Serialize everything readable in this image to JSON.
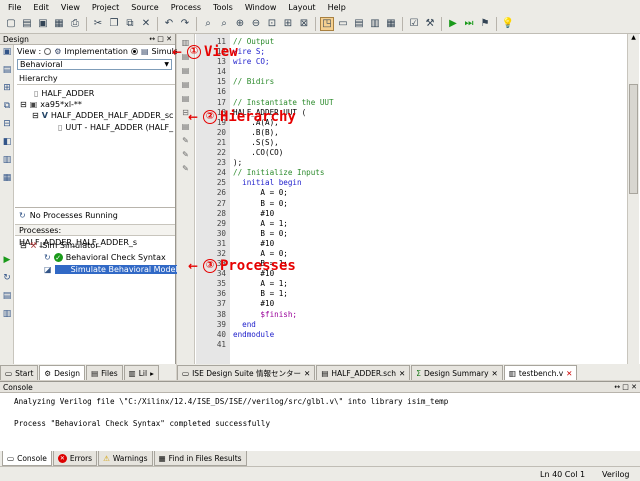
{
  "menu": [
    "File",
    "Edit",
    "View",
    "Project",
    "Source",
    "Process",
    "Tools",
    "Window",
    "Layout",
    "Help"
  ],
  "left": {
    "title": "Design",
    "view_label": "View :",
    "impl_label": "Implementation",
    "sim_label": "Simulation",
    "behavior_select": "Behavioral",
    "hierarchy_label": "Hierarchy",
    "tree": [
      "HALF_ADDER",
      "xa95*xl-**",
      "HALF_ADDER_HALF_ADDER_sc",
      "UUT - HALF_ADDER (HALF_"
    ],
    "no_processes": "No Processes Running",
    "processes_label": "Processes: HALF_ADDER_HALF_ADDER_s",
    "processes": [
      "ISim Simulator",
      "Behavioral Check Syntax",
      "Simulate Behavioral Model"
    ]
  },
  "left_tabs": [
    "Start",
    "Design",
    "Files",
    "Lil"
  ],
  "editor": {
    "line_numbers": [
      "11",
      "12",
      "13",
      "14",
      "15",
      "16",
      "17",
      "18",
      "19",
      "20",
      "21",
      "22",
      "23",
      "24",
      "25",
      "26",
      "27",
      "28",
      "29",
      "30",
      "31",
      "32",
      "33",
      "34",
      "35",
      "36",
      "37",
      "38",
      "39",
      "40",
      "41"
    ],
    "lines": [
      {
        "t": "// Output",
        "c": "cmt"
      },
      {
        "t": "wire S;",
        "c": "kw"
      },
      {
        "t": "wire CO;",
        "c": "kw"
      },
      {
        "t": "",
        "c": ""
      },
      {
        "t": "// Bidirs",
        "c": "cmt"
      },
      {
        "t": "",
        "c": ""
      },
      {
        "t": "// Instantiate the UUT",
        "c": "cmt"
      },
      {
        "t": "HALF_ADDER UUT (",
        "c": ""
      },
      {
        "t": "    .A(A),",
        "c": ""
      },
      {
        "t": "    .B(B),",
        "c": ""
      },
      {
        "t": "    .S(S),",
        "c": ""
      },
      {
        "t": "    .CO(CO)",
        "c": ""
      },
      {
        "t": ");",
        "c": ""
      },
      {
        "t": "// Initialize Inputs",
        "c": "cmt"
      },
      {
        "t": "  initial begin",
        "c": "kw"
      },
      {
        "t": "      A = 0;",
        "c": ""
      },
      {
        "t": "      B = 0;",
        "c": ""
      },
      {
        "t": "      #10",
        "c": ""
      },
      {
        "t": "      A = 1;",
        "c": ""
      },
      {
        "t": "      B = 0;",
        "c": ""
      },
      {
        "t": "      #10",
        "c": ""
      },
      {
        "t": "      A = 0;",
        "c": ""
      },
      {
        "t": "      B = 1;",
        "c": ""
      },
      {
        "t": "      #10",
        "c": ""
      },
      {
        "t": "      A = 1;",
        "c": ""
      },
      {
        "t": "      B = 1;",
        "c": ""
      },
      {
        "t": "      #10",
        "c": ""
      },
      {
        "t": "      $finish;",
        "c": "str"
      },
      {
        "t": "  end",
        "c": "kw"
      },
      {
        "t": "endmodule",
        "c": "kw"
      },
      {
        "t": "",
        "c": ""
      }
    ]
  },
  "editor_tabs": [
    "ISE Design Suite 情報センター",
    "HALF_ADDER.sch",
    "Design Summary",
    "testbench.v"
  ],
  "console": {
    "title": "Console",
    "lines": [
      "Analyzing Verilog file \\\"C:/Xilinx/12.4/ISE_DS/ISE//verilog/src/glbl.v\\\" into library isim_temp",
      "",
      "Process \"Behavioral Check Syntax\" completed successfully"
    ]
  },
  "bottom_tabs": [
    "Console",
    "Errors",
    "Warnings",
    "Find in Files Results"
  ],
  "status": {
    "position": "Ln 40 Col 1",
    "language": "Verilog"
  },
  "annotations": [
    "①",
    "View",
    "②",
    "Hierarchy",
    "③",
    "Processes"
  ],
  "colors": {
    "annotation": "#e60000",
    "selection": "#3169c6",
    "comment": "#2b8a2b",
    "keyword": "#2222cc"
  }
}
